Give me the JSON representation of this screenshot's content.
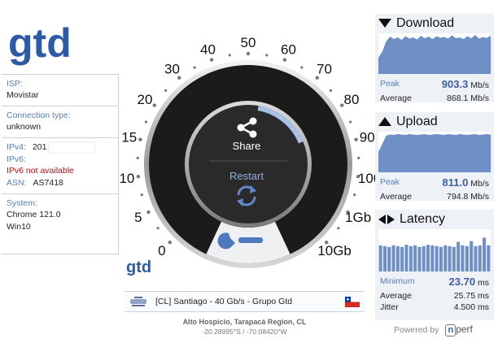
{
  "branding": {
    "logo_text": "gtd",
    "small_logo_text": "gtd"
  },
  "info": {
    "isp_label": "ISP:",
    "isp_value": "Movistar",
    "connection_label": "Connection type:",
    "connection_value": "unknown",
    "ipv4_label": "IPv4:",
    "ipv4_value": "201",
    "ipv6_label": "IPv6:",
    "ipv6_value": "IPv6 not available",
    "asn_label": "ASN:",
    "asn_value": "AS7418",
    "system_label": "System:",
    "system_browser": "Chrome 121.0",
    "system_os": "Win10"
  },
  "gauge": {
    "scale_labels": [
      "0",
      "5",
      "10",
      "15",
      "20",
      "30",
      "40",
      "50",
      "60",
      "70",
      "80",
      "90",
      "100",
      "1Gb",
      "10Gb"
    ],
    "share_label": "Share",
    "restart_label": "Restart",
    "progress_fraction": 0.16,
    "icons": [
      "share-icon",
      "restart-icon",
      "wrench-icon"
    ]
  },
  "server": {
    "name": "[CL] Santiago - 40 Gb/s - Grupo Gtd",
    "location": "Alto Hospicio, Tarapacá Region, CL",
    "coords": "-20.28995°S / -70.08420°W",
    "flag": "chile-flag-icon"
  },
  "download": {
    "title": "Download",
    "peak_label": "Peak",
    "peak_value": "903.3",
    "peak_unit": "Mb/s",
    "avg_label": "Average",
    "avg_value": "868.1 Mb/s",
    "trace": [
      0.4,
      0.55,
      0.8,
      0.92,
      0.86,
      0.9,
      0.84,
      0.93,
      0.87,
      0.9,
      0.85,
      0.94,
      0.88,
      0.92,
      0.86,
      0.93,
      0.89,
      0.91,
      0.87,
      0.95,
      0.88,
      0.9,
      0.86,
      0.93,
      0.88,
      0.96,
      0.87,
      0.91,
      0.89,
      0.94
    ]
  },
  "upload": {
    "title": "Upload",
    "peak_label": "Peak",
    "peak_value": "811.0",
    "peak_unit": "Mb/s",
    "avg_label": "Average",
    "avg_value": "794.8 Mb/s",
    "trace": [
      0.5,
      0.7,
      0.9,
      0.93,
      0.92,
      0.94,
      0.93,
      0.92,
      0.94,
      0.93,
      0.92,
      0.93,
      0.94,
      0.92,
      0.93,
      0.94,
      0.93,
      0.92,
      0.94,
      0.93,
      0.92,
      0.94,
      0.93,
      0.92,
      0.93,
      0.94,
      0.92,
      0.93,
      0.94,
      0.93
    ]
  },
  "latency": {
    "title": "Latency",
    "min_label": "Minimum",
    "min_value": "23.70",
    "min_unit": "ms",
    "avg_label": "Average",
    "avg_value": "25.75 ms",
    "jitter_label": "Jitter",
    "jitter_value": "4.500 ms",
    "bars": [
      0.62,
      0.6,
      0.58,
      0.62,
      0.6,
      0.58,
      0.63,
      0.6,
      0.62,
      0.58,
      0.6,
      0.63,
      0.62,
      0.6,
      0.58,
      0.62,
      0.6,
      0.58,
      0.7,
      0.62,
      0.6,
      0.72,
      0.6,
      0.62,
      0.8,
      0.62
    ]
  },
  "footer": {
    "powered_by": "Powered by",
    "nperf_n": "n",
    "nperf_rest": "perf"
  },
  "colors": {
    "accent": "#5a7fb2",
    "chart_fill": "#6f8fc7",
    "panel_bg": "#eef2f7",
    "dial": "#1b1b1b"
  }
}
